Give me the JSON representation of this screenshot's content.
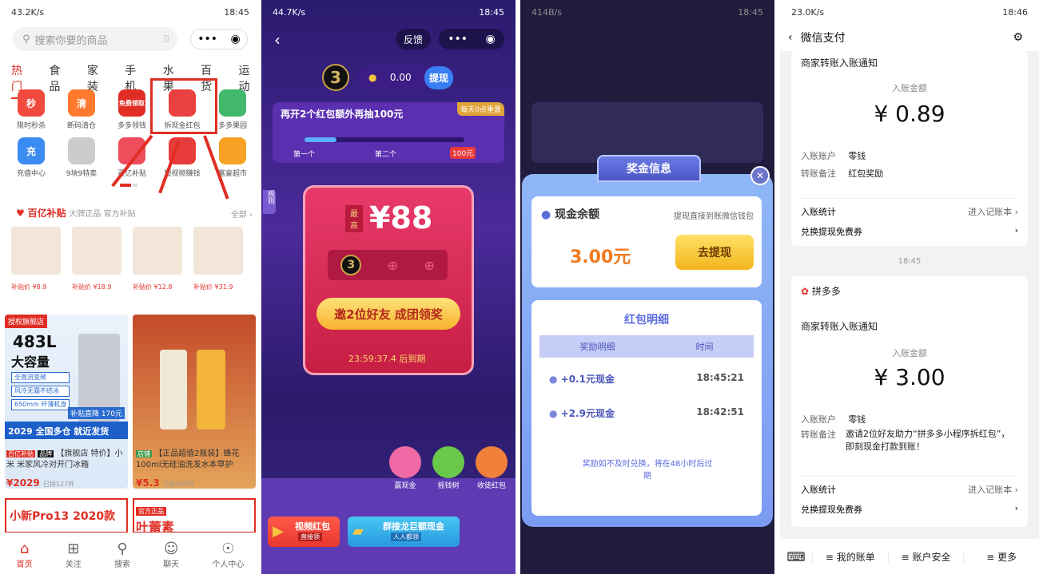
{
  "p1": {
    "status": {
      "left": "43.2K/s",
      "right": "18:45"
    },
    "search_placeholder": "搜索你要的商品",
    "cats": [
      "热门",
      "食品",
      "家装",
      "手机",
      "水果",
      "百货",
      "运动"
    ],
    "row1": [
      {
        "label": "限时秒杀",
        "g": "秒",
        "c": "#f04a3e"
      },
      {
        "label": "断码清仓",
        "g": "清",
        "c": "#ff7a2e"
      },
      {
        "label": "多多领钱",
        "g": "免费领取",
        "c": "#e02e24"
      },
      {
        "label": "拆现金红包",
        "g": "",
        "c": "#e84140"
      },
      {
        "label": "多多果园",
        "g": "",
        "c": "#41b86b"
      }
    ],
    "row2": [
      {
        "label": "充值中心",
        "g": "充",
        "c": "#3b8cf0"
      },
      {
        "label": "9块9特卖",
        "g": "",
        "c": "#cccccc"
      },
      {
        "label": "百亿补贴",
        "g": "",
        "c": "#ef4d5c"
      },
      {
        "label": "短视频赚钱",
        "g": "",
        "c": "#e83c3c"
      },
      {
        "label": "富豪超市",
        "g": "",
        "c": "#f7a224"
      }
    ],
    "bi_title": "百亿补贴",
    "bi_sub": "大牌正品 官方补贴",
    "bi_all": "全部",
    "prices": [
      "补贴价 ¥8.9",
      "补贴价 ¥18.9",
      "补贴价 ¥12.8",
      "补贴价 ¥31.9"
    ],
    "tile1": {
      "badge": "授权旗舰店",
      "cap": "483L",
      "cap2": "大容量",
      "feat": [
        "全直流变频",
        "风冷无霜不结冰",
        "650mm 纤薄机身"
      ],
      "sub": "补贴直降 170元",
      "year": "2029 全国多仓 就近发货",
      "t1": "百亿补贴",
      "t2": "品牌",
      "t3": "【旗舰店 特价】小米 米家风冷对开门冰箱",
      "price": "¥2029",
      "sold": "已拼127件"
    },
    "tile2": {
      "tag": "店铺",
      "t": "【正品超值2瓶装】蜂花100ml无硅油洗发水本草护",
      "price": "¥5.3",
      "sold": "已拼283件"
    },
    "promo1": "小新Pro13 2020款",
    "promo2": "叶蕾素",
    "promo_tag": "官方正品",
    "tabs": [
      "首页",
      "关注",
      "搜索",
      "聊天",
      "个人中心"
    ]
  },
  "p2": {
    "status": {
      "left": "44.7K/s",
      "right": "18:45"
    },
    "feedback": "反馈",
    "coins": "0.00",
    "withdraw": "提现",
    "banner": "再开2个红包额外再抽100元",
    "banner_tag": "每天0点重置",
    "steps": [
      "第一个",
      "第二个",
      "100元"
    ],
    "best": "最高",
    "big": "¥88",
    "invite": "邀2位好友 成团领奖",
    "timer": "23:59:37.4 后到期",
    "side": "规则",
    "bottom_icons": [
      "赢现金",
      "摇钱树",
      "收徒红包"
    ],
    "btn1": "视频红包",
    "btn1s": "直接领",
    "btn2": "群接龙巨额现金",
    "btn2s": "人人都领"
  },
  "p3": {
    "status": {
      "left": "414B/s",
      "right": "18:45"
    },
    "modal_title": "奖金信息",
    "cash_label": "现金余额",
    "cash_hint": "提现直接到账微信钱包",
    "cash": "3.00元",
    "withdraw": "去提现",
    "detail_title": "红包明细",
    "col1": "奖励明细",
    "col2": "时间",
    "rows": [
      {
        "a": "+0.1元现金",
        "t": "18:45:21"
      },
      {
        "a": "+2.9元现金",
        "t": "18:42:51"
      }
    ],
    "note": "奖励如不及时兑换，将在48小时后过期"
  },
  "p4": {
    "status": {
      "left": "23.0K/s",
      "right": "18:46"
    },
    "title": "微信支付",
    "c1": {
      "head": "商家转账入账通知",
      "amt_label": "入账金额",
      "amt": "¥ 0.89",
      "acct_l": "入账账户",
      "acct": "零钱",
      "note_l": "转账备注",
      "note": "红包奖励",
      "stat": "入账统计",
      "book": "进入记账本",
      "coupon": "兑换提现免费券"
    },
    "time": "18:45",
    "c2": {
      "from": "拼多多",
      "head": "商家转账入账通知",
      "amt_label": "入账金额",
      "amt": "¥ 3.00",
      "acct_l": "入账账户",
      "acct": "零钱",
      "note_l": "转账备注",
      "note": "邀请2位好友助力“拼多多小程序拆红包”，即刻现金打款到账！",
      "stat": "入账统计",
      "book": "进入记账本",
      "coupon": "兑换提现免费券"
    },
    "menu": [
      "我的账单",
      "账户安全",
      "更多"
    ]
  }
}
